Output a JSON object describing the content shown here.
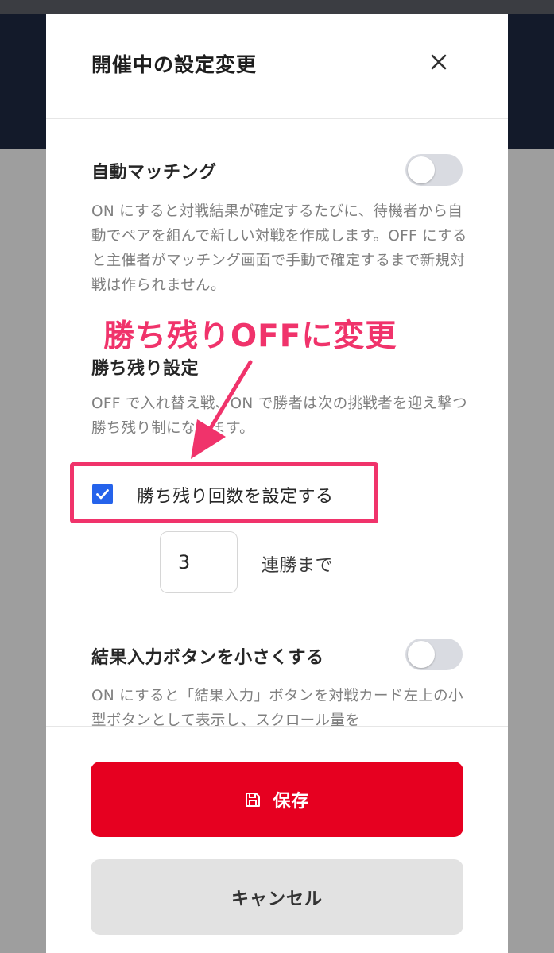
{
  "modal": {
    "title": "開催中の設定変更",
    "close_icon": "close-icon"
  },
  "auto_matching": {
    "label": "自動マッチング",
    "enabled": false,
    "description": "ON にすると対戦結果が確定するたびに、待機者から自動でペアを組んで新しい対戦を作成します。OFF にすると主催者がマッチング画面で手動で確定するまで新規対戦は作られません。"
  },
  "winner_stays": {
    "label": "勝ち残り設定",
    "description": "OFF で入れ替え戦、ON で勝者は次の挑戦者を迎え撃つ勝ち残り制になります。",
    "set_count": {
      "label": "勝ち残り回数を設定する",
      "checked": true
    },
    "count_value": "3",
    "count_unit": "連勝まで"
  },
  "small_result_button": {
    "label": "結果入力ボタンを小さくする",
    "enabled": false,
    "description": "ON にすると「結果入力」ボタンを対戦カード左上の小型ボタンとして表示し、スクロール量を"
  },
  "footer": {
    "save_label": "保存",
    "save_icon": "save-icon",
    "cancel_label": "キャンセル"
  },
  "annotation": {
    "text": "勝ち残りOFFに変更",
    "color": "#f0336b"
  },
  "colors": {
    "accent_red": "#e60020",
    "checkbox_blue": "#2563eb",
    "header_dark": "#131a2a"
  }
}
